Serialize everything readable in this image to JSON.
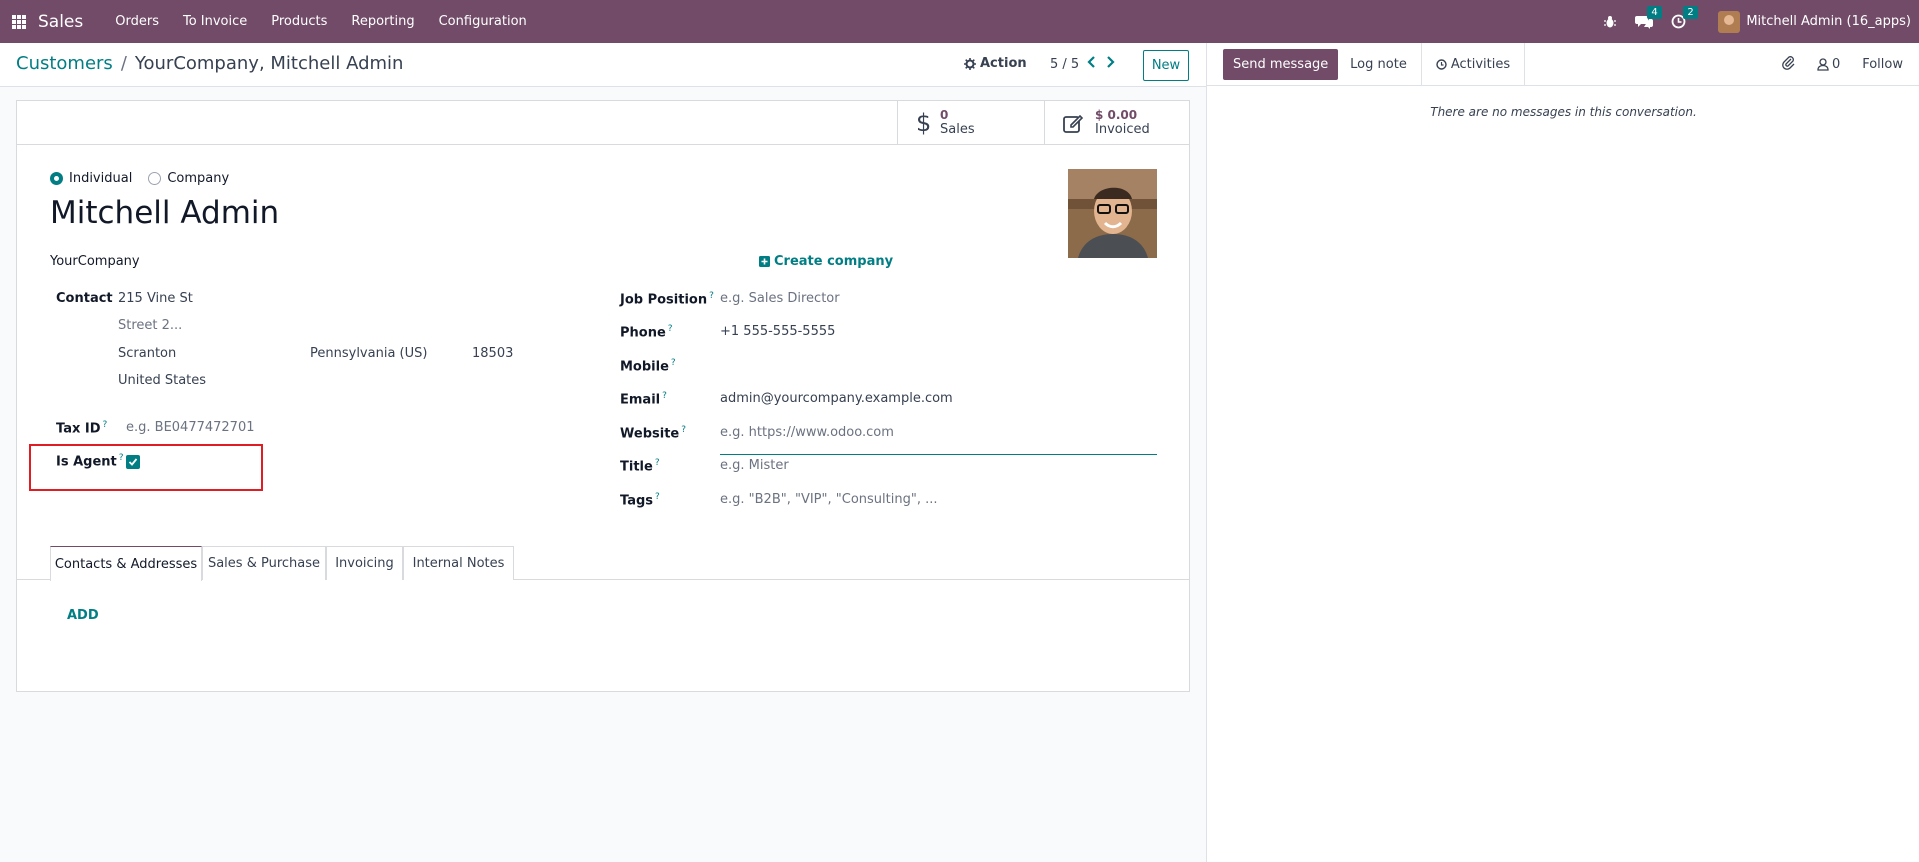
{
  "app": {
    "brand": "Sales",
    "menu": [
      "Orders",
      "To Invoice",
      "Products",
      "Reporting",
      "Configuration"
    ],
    "messages_badge": "4",
    "activities_badge": "2",
    "user": "Mitchell Admin (16_apps)"
  },
  "control": {
    "breadcrumb_parent": "Customers",
    "breadcrumb_sep": "/",
    "breadcrumb_current": "YourCompany, Mitchell Admin",
    "action_label": "Action",
    "pager": "5 / 5",
    "new_label": "New"
  },
  "smart_buttons": {
    "sales_value": "0",
    "sales_label": "Sales",
    "invoiced_value": "$ 0.00",
    "invoiced_label": "Invoiced"
  },
  "form": {
    "type_individual": "Individual",
    "type_company": "Company",
    "name": "Mitchell Admin",
    "company": "YourCompany",
    "create_company": "Create company",
    "contact_label": "Contact",
    "street": "215 Vine St",
    "street2_placeholder": "Street 2...",
    "city": "Scranton",
    "state": "Pennsylvania (US)",
    "zip": "18503",
    "country": "United States",
    "tax_label": "Tax ID",
    "tax_placeholder": "e.g. BE0477472701",
    "agent_label": "Is Agent",
    "job_label": "Job Position",
    "job_placeholder": "e.g. Sales Director",
    "phone_label": "Phone",
    "phone": "+1 555-555-5555",
    "mobile_label": "Mobile",
    "email_label": "Email",
    "email": "admin@yourcompany.example.com",
    "website_label": "Website",
    "website_placeholder": "e.g. https://www.odoo.com",
    "title_label": "Title",
    "title_placeholder": "e.g. Mister",
    "tags_label": "Tags",
    "tags_placeholder": "e.g. \"B2B\", \"VIP\", \"Consulting\", ...",
    "help_mark": "?"
  },
  "tabs": [
    "Contacts & Addresses",
    "Sales & Purchase",
    "Invoicing",
    "Internal Notes"
  ],
  "add_label": "ADD",
  "chatter": {
    "send_message": "Send message",
    "log_note": "Log note",
    "activities": "Activities",
    "followers_count": "0",
    "follow": "Follow",
    "empty": "There are no messages in this conversation."
  },
  "colors": {
    "brand": "#714b67",
    "accent": "#017e84",
    "highlight": "#e11d24"
  }
}
